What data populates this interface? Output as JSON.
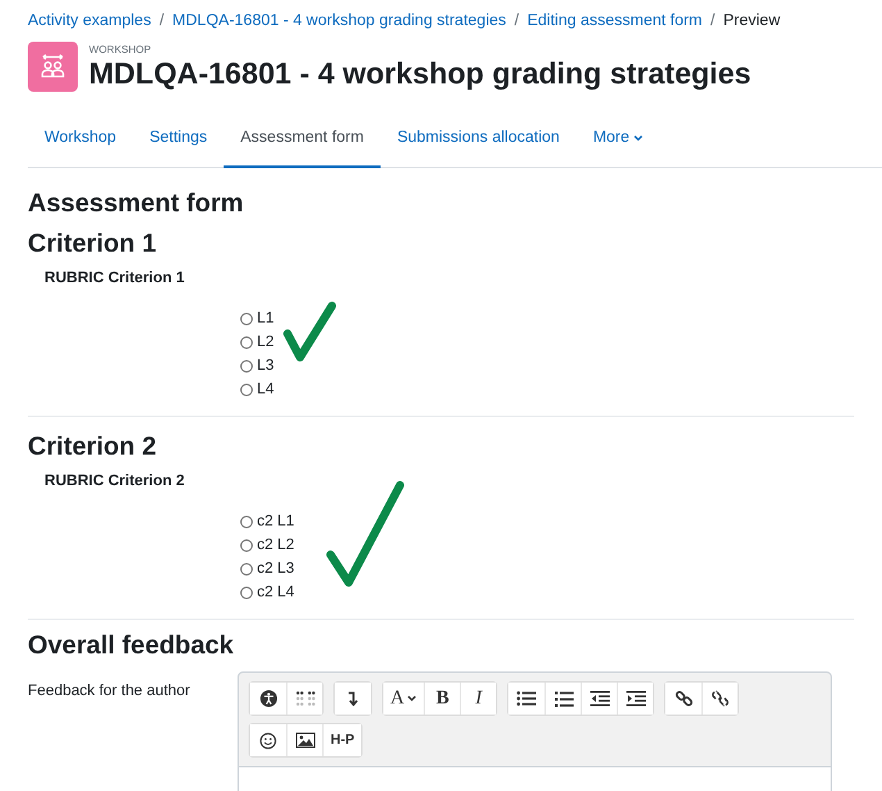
{
  "breadcrumb": [
    {
      "kind": "link",
      "label": "Activity examples"
    },
    {
      "kind": "separator",
      "label": "/"
    },
    {
      "kind": "link",
      "label": "MDLQA-16801 - 4 workshop grading strategies"
    },
    {
      "kind": "separator",
      "label": "/"
    },
    {
      "kind": "link",
      "label": "Editing assessment form"
    },
    {
      "kind": "separator",
      "label": "/"
    },
    {
      "kind": "current",
      "label": "Preview"
    }
  ],
  "header": {
    "kicker": "WORKSHOP",
    "title": "MDLQA-16801 - 4 workshop grading strategies"
  },
  "tabs": [
    {
      "label": "Workshop",
      "selected": false
    },
    {
      "label": "Settings",
      "selected": false
    },
    {
      "label": "Assessment form",
      "selected": true
    },
    {
      "label": "Submissions allocation",
      "selected": false
    },
    {
      "label": "More",
      "selected": false,
      "dropdown": true
    }
  ],
  "page_heading": "Assessment form",
  "criteria": [
    {
      "title": "Criterion 1",
      "rubric": "RUBRIC Criterion 1",
      "levels": [
        {
          "label": "L1",
          "selected": false
        },
        {
          "label": "L2",
          "selected": false
        },
        {
          "label": "L3",
          "selected": false
        },
        {
          "label": "L4",
          "selected": false
        }
      ]
    },
    {
      "title": "Criterion 2",
      "rubric": "RUBRIC Criterion 2",
      "levels": [
        {
          "label": "c2 L1",
          "selected": false
        },
        {
          "label": "c2 L2",
          "selected": false
        },
        {
          "label": "c2 L3",
          "selected": false
        },
        {
          "label": "c2 L4",
          "selected": false
        }
      ]
    }
  ],
  "feedback": {
    "heading": "Overall feedback",
    "label": "Feedback for the author",
    "toolbar_rows": [
      [
        [
          {
            "kind": "accessibility"
          },
          {
            "kind": "braille"
          }
        ],
        [
          {
            "kind": "return"
          }
        ],
        [
          {
            "kind": "font",
            "label": "A"
          },
          {
            "kind": "bold",
            "label": "B"
          },
          {
            "kind": "italic",
            "label": "I"
          }
        ],
        [
          {
            "kind": "bullets"
          },
          {
            "kind": "numbers"
          },
          {
            "kind": "outdent"
          },
          {
            "kind": "indent"
          }
        ],
        [
          {
            "kind": "link"
          },
          {
            "kind": "unlink"
          }
        ]
      ],
      [
        [
          {
            "kind": "emoji"
          },
          {
            "kind": "image"
          },
          {
            "kind": "h5p",
            "label": "H-P"
          }
        ]
      ]
    ]
  }
}
